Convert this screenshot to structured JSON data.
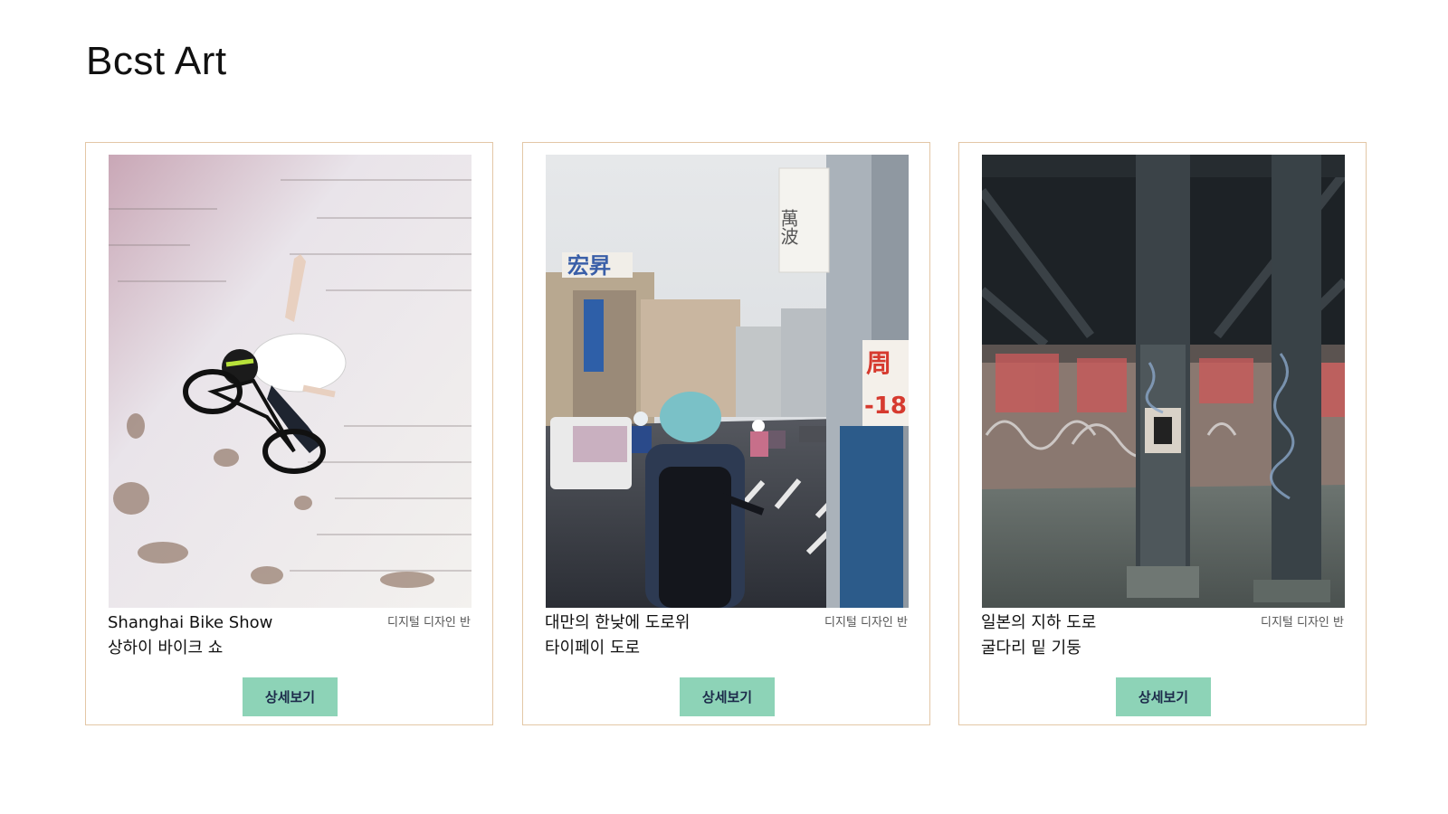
{
  "page": {
    "title": "Bcst Art"
  },
  "cards": [
    {
      "image": "bmx-rider-against-brick-wall-photo",
      "title_line1": "Shanghai Bike Show",
      "title_line2": "상하이 바이크  쇼",
      "category": "디지털 디자인 반",
      "button_label": "상세보기"
    },
    {
      "image": "taipei-street-scooters-photo",
      "title_line1": "대만의 한낮에 도로위",
      "title_line2": "타이페이 도로",
      "category": "디지털 디자인 반",
      "button_label": "상세보기"
    },
    {
      "image": "graffiti-pillars-under-bridge-photo",
      "title_line1": "일본의 지하 도로",
      "title_line2": "굴다리 밑 기둥",
      "category": "디지털 디자인 반",
      "button_label": "상세보기"
    }
  ],
  "colors": {
    "card_border": "#e3c7a6",
    "button_bg": "#8dd3b7",
    "button_text": "#1c2a4a"
  },
  "photo_signs": {
    "card2_sign_left": "宏昇",
    "card2_sign_top": "萬波",
    "card2_sign_red": "周",
    "card2_sign_red_number": "-18"
  }
}
